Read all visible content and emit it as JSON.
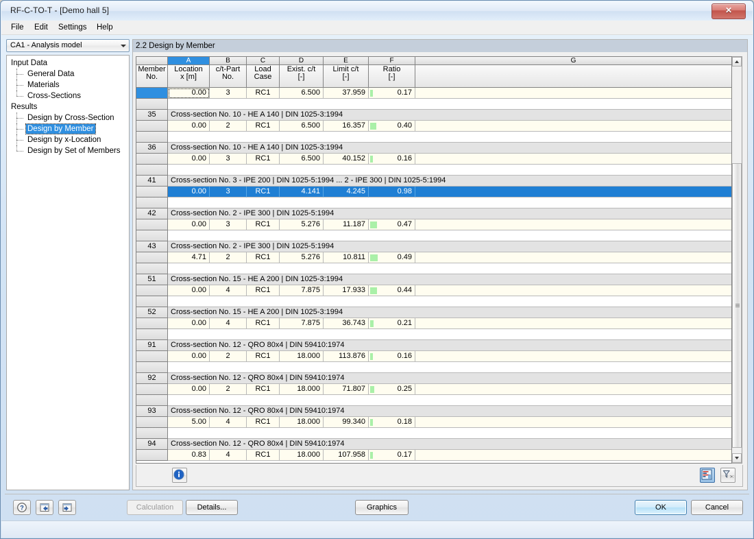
{
  "window": {
    "title": "RF-C-TO-T - [Demo hall 5]",
    "close_label": "✕"
  },
  "menu": {
    "items": [
      {
        "label": "File"
      },
      {
        "label": "Edit"
      },
      {
        "label": "Settings"
      },
      {
        "label": "Help"
      }
    ]
  },
  "sidebar": {
    "combo_value": "CA1 - Analysis model",
    "tree": [
      {
        "label": "Input Data",
        "level": 0,
        "selected": false
      },
      {
        "label": "General Data",
        "level": 1,
        "selected": false
      },
      {
        "label": "Materials",
        "level": 1,
        "selected": false
      },
      {
        "label": "Cross-Sections",
        "level": 1,
        "selected": false,
        "last": true
      },
      {
        "label": "Results",
        "level": 0,
        "selected": false
      },
      {
        "label": "Design by Cross-Section",
        "level": 1,
        "selected": false
      },
      {
        "label": "Design by Member",
        "level": 1,
        "selected": true
      },
      {
        "label": "Design by x-Location",
        "level": 1,
        "selected": false
      },
      {
        "label": "Design by Set of Members",
        "level": 1,
        "selected": false,
        "last": true
      }
    ],
    "buttons": [
      {
        "name": "help-button",
        "icon": "question-icon"
      },
      {
        "name": "previous-button",
        "icon": "arrow-left-icon"
      },
      {
        "name": "next-button",
        "icon": "arrow-right-icon"
      }
    ]
  },
  "main": {
    "panel_title": "2.2 Design by Member",
    "grid": {
      "column_letters": [
        "",
        "A",
        "B",
        "C",
        "D",
        "E",
        "F",
        "G"
      ],
      "active_letter": "A",
      "column_headers": [
        {
          "lines": [
            "Member",
            "No."
          ]
        },
        {
          "lines": [
            "Location",
            "x [m]"
          ]
        },
        {
          "lines": [
            "c/t-Part",
            "No."
          ]
        },
        {
          "lines": [
            "Load",
            "Case"
          ]
        },
        {
          "lines": [
            "Exist. c/t",
            "[-]"
          ]
        },
        {
          "lines": [
            "Limit c/t",
            "[-]"
          ]
        },
        {
          "lines": [
            "Ratio",
            "[-]"
          ]
        },
        {
          "lines": [
            ""
          ]
        }
      ],
      "rows": [
        {
          "type": "data",
          "member": "",
          "member_blue": true,
          "location": "0.00",
          "ct_part": "3",
          "load_case": "RC1",
          "exist_ct": "6.500",
          "limit_ct": "37.959",
          "ratio": "0.17",
          "focus": true
        },
        {
          "type": "blank"
        },
        {
          "type": "section",
          "member": "35",
          "text": "Cross-section No.  10 - HE A 140 | DIN 1025-3:1994"
        },
        {
          "type": "data",
          "member": "",
          "location": "0.00",
          "ct_part": "2",
          "load_case": "RC1",
          "exist_ct": "6.500",
          "limit_ct": "16.357",
          "ratio": "0.40"
        },
        {
          "type": "blank"
        },
        {
          "type": "section",
          "member": "36",
          "text": "Cross-section No.  10 - HE A 140 | DIN 1025-3:1994"
        },
        {
          "type": "data",
          "member": "",
          "location": "0.00",
          "ct_part": "3",
          "load_case": "RC1",
          "exist_ct": "6.500",
          "limit_ct": "40.152",
          "ratio": "0.16"
        },
        {
          "type": "blank"
        },
        {
          "type": "section",
          "member": "41",
          "text": "Cross-section No. 3 - IPE 200 | DIN 1025-5:1994 ... 2 - IPE 300 | DIN 1025-5:1994"
        },
        {
          "type": "data",
          "member": "",
          "location": "0.00",
          "ct_part": "3",
          "load_case": "RC1",
          "exist_ct": "4.141",
          "limit_ct": "4.245",
          "ratio": "0.98",
          "selected": true
        },
        {
          "type": "blank"
        },
        {
          "type": "section",
          "member": "42",
          "text": "Cross-section No.  2 - IPE 300 | DIN 1025-5:1994"
        },
        {
          "type": "data",
          "member": "",
          "location": "0.00",
          "ct_part": "3",
          "load_case": "RC1",
          "exist_ct": "5.276",
          "limit_ct": "11.187",
          "ratio": "0.47"
        },
        {
          "type": "blank"
        },
        {
          "type": "section",
          "member": "43",
          "text": "Cross-section No.  2 - IPE 300 | DIN 1025-5:1994"
        },
        {
          "type": "data",
          "member": "",
          "location": "4.71",
          "ct_part": "2",
          "load_case": "RC1",
          "exist_ct": "5.276",
          "limit_ct": "10.811",
          "ratio": "0.49"
        },
        {
          "type": "blank"
        },
        {
          "type": "section",
          "member": "51",
          "text": "Cross-section No.  15 - HE A 200 | DIN 1025-3:1994"
        },
        {
          "type": "data",
          "member": "",
          "location": "0.00",
          "ct_part": "4",
          "load_case": "RC1",
          "exist_ct": "7.875",
          "limit_ct": "17.933",
          "ratio": "0.44"
        },
        {
          "type": "blank"
        },
        {
          "type": "section",
          "member": "52",
          "text": "Cross-section No.  15 - HE A 200 | DIN 1025-3:1994"
        },
        {
          "type": "data",
          "member": "",
          "location": "0.00",
          "ct_part": "4",
          "load_case": "RC1",
          "exist_ct": "7.875",
          "limit_ct": "36.743",
          "ratio": "0.21"
        },
        {
          "type": "blank"
        },
        {
          "type": "section",
          "member": "91",
          "text": "Cross-section No.  12 - QRO 80x4 | DIN 59410:1974"
        },
        {
          "type": "data",
          "member": "",
          "location": "0.00",
          "ct_part": "2",
          "load_case": "RC1",
          "exist_ct": "18.000",
          "limit_ct": "113.876",
          "ratio": "0.16"
        },
        {
          "type": "blank"
        },
        {
          "type": "section",
          "member": "92",
          "text": "Cross-section No.  12 - QRO 80x4 | DIN 59410:1974"
        },
        {
          "type": "data",
          "member": "",
          "location": "0.00",
          "ct_part": "2",
          "load_case": "RC1",
          "exist_ct": "18.000",
          "limit_ct": "71.807",
          "ratio": "0.25"
        },
        {
          "type": "blank"
        },
        {
          "type": "section",
          "member": "93",
          "text": "Cross-section No.  12 - QRO 80x4 | DIN 59410:1974"
        },
        {
          "type": "data",
          "member": "",
          "location": "5.00",
          "ct_part": "4",
          "load_case": "RC1",
          "exist_ct": "18.000",
          "limit_ct": "99.340",
          "ratio": "0.18"
        },
        {
          "type": "blank"
        },
        {
          "type": "section",
          "member": "94",
          "text": "Cross-section No.  12 - QRO 80x4 | DIN 59410:1974"
        },
        {
          "type": "data",
          "member": "",
          "location": "0.83",
          "ct_part": "4",
          "load_case": "RC1",
          "exist_ct": "18.000",
          "limit_ct": "107.958",
          "ratio": "0.17"
        }
      ]
    },
    "grid_toolbar": {
      "info_button": "info-icon",
      "results_button": "results-chart-icon",
      "filter_button": "filter-icon"
    }
  },
  "footer": {
    "calculation_label": "Calculation",
    "details_label": "Details...",
    "graphics_label": "Graphics",
    "ok_label": "OK",
    "cancel_label": "Cancel"
  },
  "colors": {
    "accent": "#2f8fe0",
    "selection": "#1f7fd4",
    "ratio_bar": "#aaf0a8",
    "cell_bg": "#fffdf0",
    "section_bg": "#e3e3e3"
  }
}
